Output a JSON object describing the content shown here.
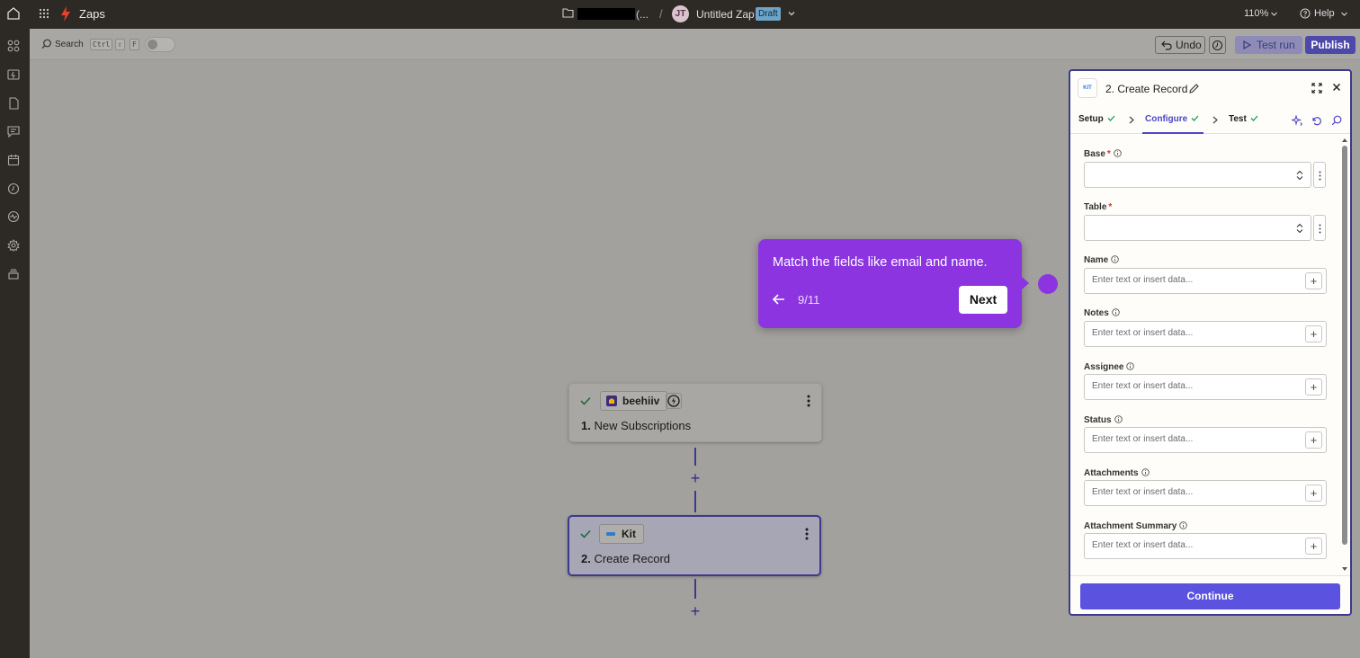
{
  "topbar": {
    "app_name": "Zaps",
    "folder_ellipsis": "(...",
    "separator": "/",
    "avatar_initials": "JT",
    "zap_title": "Untitled Zap",
    "status_badge": "Draft",
    "zoom": "110%",
    "help": "Help"
  },
  "toolbar": {
    "search_label": "Search",
    "shortcut_keys": [
      "Ctrl",
      "⇧",
      "F"
    ],
    "undo": "Undo",
    "test_run": "Test run",
    "publish": "Publish"
  },
  "steps": [
    {
      "app": "beehiiv",
      "number": "1.",
      "title": "New Subscriptions"
    },
    {
      "app": "Kit",
      "number": "2.",
      "title": "Create Record"
    }
  ],
  "connector_plus": "+",
  "tooltip": {
    "text": "Match the fields like email and name.",
    "counter": "9/11",
    "next": "Next"
  },
  "panel": {
    "logo_text": "KIT",
    "title": "2. Create Record",
    "tabs": [
      {
        "label": "Setup",
        "checked": true
      },
      {
        "label": "Configure",
        "checked": true,
        "active": true
      },
      {
        "label": "Test",
        "checked": true
      }
    ],
    "fields": [
      {
        "label": "Base",
        "required": true,
        "info": true,
        "type": "select"
      },
      {
        "label": "Table",
        "required": true,
        "info": false,
        "type": "select"
      },
      {
        "label": "Name",
        "info": true,
        "type": "text",
        "placeholder": "Enter text or insert data..."
      },
      {
        "label": "Notes",
        "info": true,
        "type": "text",
        "placeholder": "Enter text or insert data..."
      },
      {
        "label": "Assignee",
        "info": true,
        "type": "text",
        "placeholder": "Enter text or insert data..."
      },
      {
        "label": "Status",
        "info": true,
        "type": "text",
        "placeholder": "Enter text or insert data..."
      },
      {
        "label": "Attachments",
        "info": true,
        "type": "text",
        "placeholder": "Enter text or insert data..."
      },
      {
        "label": "Attachment Summary",
        "info": true,
        "type": "text",
        "placeholder": "Enter text or insert data..."
      }
    ],
    "required_mark": "*",
    "continue": "Continue"
  },
  "colors": {
    "accent": "#4c46c6",
    "tooltip": "#8b34e0",
    "publish": "#4d49a8",
    "continue": "#5b52e0",
    "check": "#1f9d55"
  }
}
